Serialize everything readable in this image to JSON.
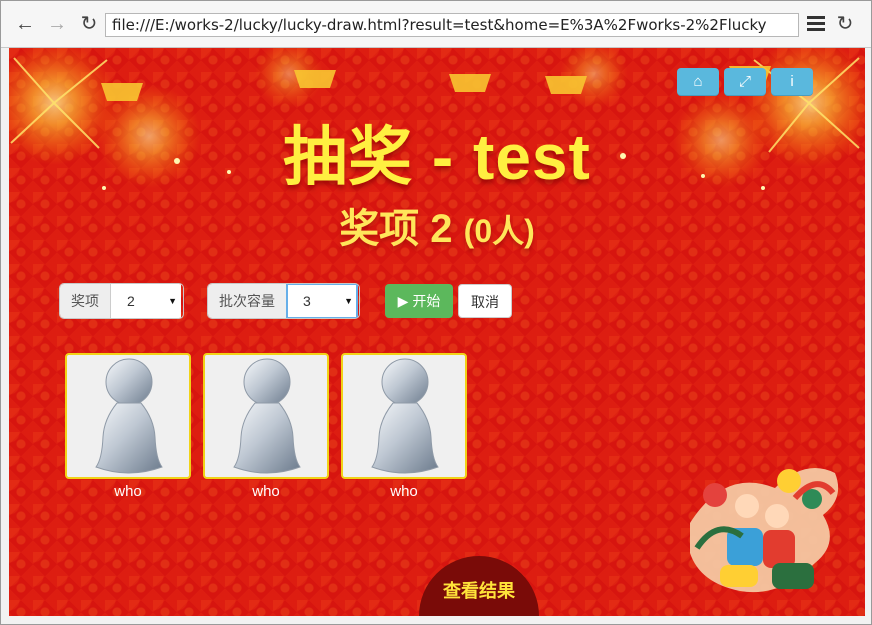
{
  "browser": {
    "back_icon": "arrow-left-icon",
    "forward_icon": "arrow-right-icon",
    "reload_icon": "reload-icon",
    "url": "file:///E:/works-2/lucky/lucky-draw.html?result=test&home=E%3A%2Fworks-2%2Flucky",
    "menu_icon": "hamburger-menu-icon",
    "refresh_icon": "refresh-icon"
  },
  "page": {
    "title": "抽奖 - test",
    "prize_label": "奖项 2",
    "prize_count": "(0人)",
    "top_buttons": [
      "home-icon",
      "fullscreen-icon",
      "info-icon"
    ],
    "controls": {
      "prize_addon": "奖项",
      "prize_value": "2",
      "batch_addon": "批次容量",
      "batch_value": "3",
      "start_label": "开始",
      "cancel_label": "取消"
    },
    "cards": [
      {
        "name": "who"
      },
      {
        "name": "who"
      },
      {
        "name": "who"
      }
    ],
    "result_label": "查看结果"
  },
  "colors": {
    "background": "#d7150f",
    "title": "#ffef40",
    "start_button": "#5cb85c",
    "top_buttons": "#5ab8dd",
    "card_border": "#f1d316"
  }
}
